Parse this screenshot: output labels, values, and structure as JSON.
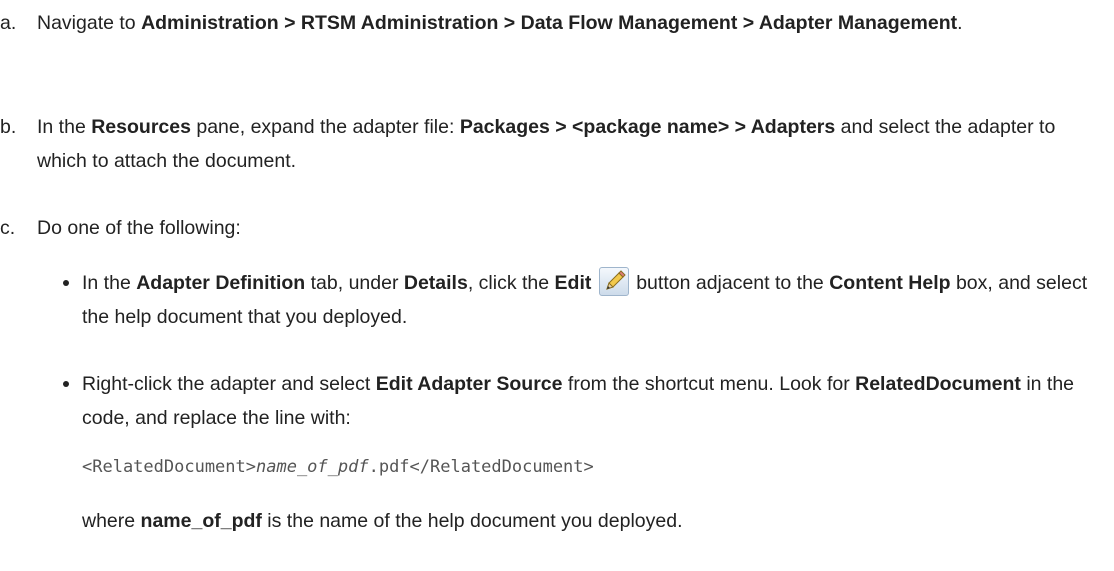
{
  "steps": [
    {
      "letter": "a.",
      "t1": "Navigate to ",
      "path": "Administration > RTSM Administration > Data Flow Management > Adapter Management",
      "t2": "."
    },
    {
      "letter": "b.",
      "t1": "In the ",
      "b1": "Resources",
      "t2": " pane, expand the adapter file: ",
      "b2": "Packages > <package name> > Adapters",
      "t3": " and select the adapter to which to attach the document."
    },
    {
      "letter": "c.",
      "t1": "Do one of the following:"
    }
  ],
  "bullets": [
    {
      "t1": "In the ",
      "b1": "Adapter Definition",
      "t2": " tab, under ",
      "b2": "Details",
      "t3": ", click the ",
      "b3": "Edit",
      "icon": "pencil-edit-icon",
      "t4": " button adjacent to the ",
      "b4": "Content Help",
      "t5": " box, and select the help document that you deployed."
    },
    {
      "t1": "Right-click the adapter and select ",
      "b1": "Edit Adapter Source",
      "t2": " from the shortcut menu. Look for ",
      "b2": "RelatedDocument",
      "t3": " in the code, and replace the line with:"
    }
  ],
  "code": {
    "open_tag": "<RelatedDocument>",
    "var": "name_of_pdf",
    "suffix": ".pdf</RelatedDocument>"
  },
  "note": {
    "t1": "where ",
    "b1": "name_of_pdf",
    "t2": " is the name of the help document you deployed."
  }
}
